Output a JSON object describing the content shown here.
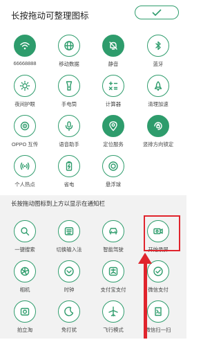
{
  "header": {
    "title": "长按拖动可整理图标",
    "done_icon": "check-icon"
  },
  "colors": {
    "accent": "#2e9c6c",
    "highlight": "#e0242c",
    "lower_bg": "#f2f2f2"
  },
  "active_tiles": [
    {
      "id": "wifi",
      "label": "66668888",
      "icon": "wifi-icon",
      "on": true
    },
    {
      "id": "mobile-data",
      "label": "移动数据",
      "icon": "globe-icon",
      "on": false
    },
    {
      "id": "silent",
      "label": "静音",
      "icon": "bell-off-icon",
      "on": true
    },
    {
      "id": "bluetooth",
      "label": "蓝牙",
      "icon": "bluetooth-icon",
      "on": false
    },
    {
      "id": "eye-care",
      "label": "夜间护眼",
      "icon": "sun-icon",
      "on": false
    },
    {
      "id": "flashlight",
      "label": "手电筒",
      "icon": "flashlight-icon",
      "on": false
    },
    {
      "id": "calculator",
      "label": "计算器",
      "icon": "calculator-icon",
      "on": false
    },
    {
      "id": "cleanup",
      "label": "清理加速",
      "icon": "rocket-icon",
      "on": false
    },
    {
      "id": "oppo-share",
      "label": "OPPO 互传",
      "icon": "share-icon",
      "on": false
    },
    {
      "id": "voice-assistant",
      "label": "语音助手",
      "icon": "mic-icon",
      "on": false
    },
    {
      "id": "location",
      "label": "定位服务",
      "icon": "location-icon",
      "on": true
    },
    {
      "id": "rotation-lock",
      "label": "竖排方向锁定",
      "icon": "rotation-lock-icon",
      "on": true
    },
    {
      "id": "hotspot",
      "label": "个人热点",
      "icon": "hotspot-icon",
      "on": false
    },
    {
      "id": "power-saving",
      "label": "省电",
      "icon": "battery-icon",
      "on": false
    },
    {
      "id": "floating-ball",
      "label": "悬浮球",
      "icon": "floating-ball-icon",
      "on": false
    }
  ],
  "inactive_section": {
    "title": "长按拖动图标到上方以显示在通知栏",
    "tiles": [
      {
        "id": "search",
        "label": "一键搜索",
        "icon": "search-icon"
      },
      {
        "id": "input-method",
        "label": "切换输入法",
        "icon": "keyboard-icon"
      },
      {
        "id": "smart-driving",
        "label": "智能驾驶",
        "icon": "car-icon"
      },
      {
        "id": "screen-record",
        "label": "开始录屏",
        "icon": "video-camera-icon"
      },
      {
        "id": "camera",
        "label": "相机",
        "icon": "camera-icon"
      },
      {
        "id": "clock",
        "label": "时钟",
        "icon": "clock-icon"
      },
      {
        "id": "alipay",
        "label": "支付宝支付",
        "icon": "alipay-icon"
      },
      {
        "id": "wechat-pay",
        "label": "微信支付",
        "icon": "wechat-pay-icon"
      },
      {
        "id": "taobao",
        "label": "拍立淘",
        "icon": "taobao-camera-icon"
      },
      {
        "id": "do-not-disturb",
        "label": "免打扰",
        "icon": "moon-icon"
      },
      {
        "id": "airplane",
        "label": "飞行模式",
        "icon": "airplane-icon"
      },
      {
        "id": "wechat-scan",
        "label": "微信扫一扫",
        "icon": "scan-icon"
      }
    ]
  }
}
